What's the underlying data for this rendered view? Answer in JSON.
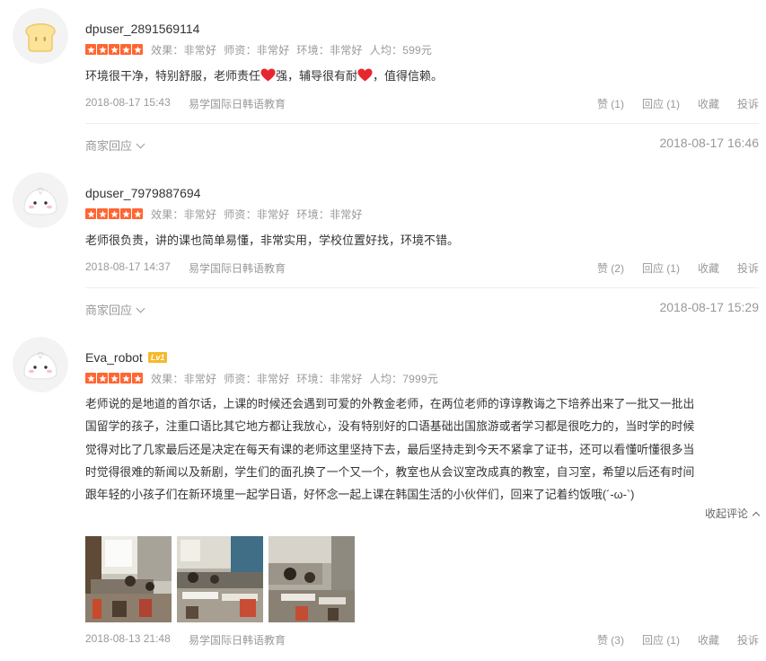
{
  "reviews": [
    {
      "username": "dpuser_2891569114",
      "scores": [
        "效果：非常好",
        "师资：非常好",
        "环境：非常好",
        "人均：599元"
      ],
      "content_parts": [
        "环境很干净，特别舒服，老师责任",
        "强，辅导很有耐",
        "，值得信赖。"
      ],
      "date": "2018-08-17 15:43",
      "shop": "易学国际日韩语教育",
      "like": "赞 (1)",
      "reply": "回应 (1)",
      "favorite": "收藏",
      "report": "投诉",
      "merchant_reply": "商家回应",
      "merchant_reply_date": "2018-08-17 16:46"
    },
    {
      "username": "dpuser_7979887694",
      "scores": [
        "效果：非常好",
        "师资：非常好",
        "环境：非常好"
      ],
      "content": "老师很负责，讲的课也简单易懂，非常实用，学校位置好找，环境不错。",
      "date": "2018-08-17 14:37",
      "shop": "易学国际日韩语教育",
      "like": "赞 (2)",
      "reply": "回应 (1)",
      "favorite": "收藏",
      "report": "投诉",
      "merchant_reply": "商家回应",
      "merchant_reply_date": "2018-08-17 15:29"
    },
    {
      "username": "Eva_robot",
      "level": "Lv1",
      "scores": [
        "效果：非常好",
        "师资：非常好",
        "环境：非常好",
        "人均：7999元"
      ],
      "content_lines": [
        "老师说的是地道的首尔话，上课的时候还会遇到可爱的外教金老师，在两位老师的谆谆教诲之下培养出来了一批又一批出",
        "国留学的孩子，注重口语比其它地方都让我放心，没有特别好的口语基础出国旅游或者学习都是很吃力的，当时学的时候",
        "觉得对比了几家最后还是决定在每天有课的老师这里坚持下去，最后坚持走到今天不紧拿了证书，还可以看懂听懂很多当",
        "时觉得很难的新闻以及新剧，学生们的面孔换了一个又一个，教室也从会议室改成真的教室，自习室，希望以后还有时间",
        "跟年轻的小孩子们在新环境里一起学日语，好怀念一起上课在韩国生活的小伙伴们，回来了记着约饭哦(´-ω-`)"
      ],
      "collapse": "收起评论",
      "date": "2018-08-13 21:48",
      "shop": "易学国际日韩语教育",
      "like": "赞 (3)",
      "reply": "回应 (1)",
      "favorite": "收藏",
      "report": "投诉"
    }
  ],
  "colors": {
    "star": "#ff6633",
    "heart": "#e8262d",
    "badge": "#f7b92b"
  }
}
